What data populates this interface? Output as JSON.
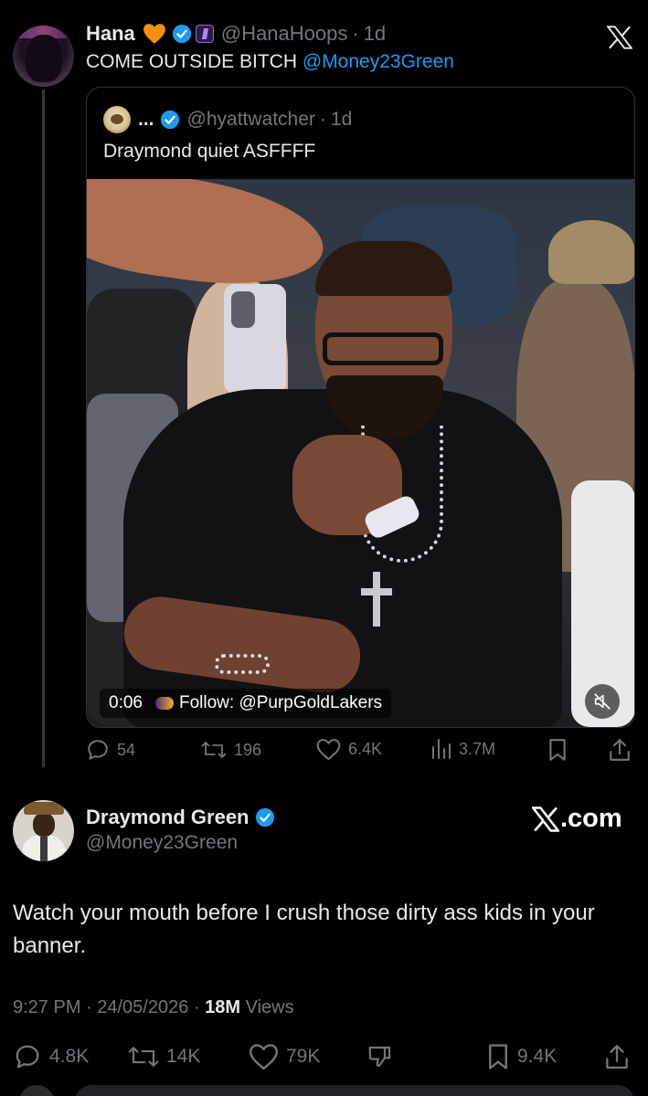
{
  "parent_tweet": {
    "name": "Hana",
    "handle": "@HanaHoops",
    "separator": "·",
    "time": "1d",
    "text_prefix": "COME OUTSIDE BITCH ",
    "mention": "@Money23Green"
  },
  "quote": {
    "name": "...",
    "handle": "@hyattwatcher",
    "separator": "·",
    "time": "1d",
    "text": "Draymond quiet ASFFFF",
    "video_time": "0:06",
    "video_overlay": "Follow: @PurpGoldLakers"
  },
  "parent_actions": {
    "replies": "54",
    "reposts": "196",
    "likes": "6.4K",
    "views": "3.7M"
  },
  "reply_tweet": {
    "name": "Draymond Green",
    "handle": "@Money23Green",
    "brand": ".com",
    "text": "Watch your mouth before I crush those dirty ass kids in your banner.",
    "timestamp": "9:27 PM · 24/05/2026 · ",
    "views_count": "18M",
    "views_label": " Views"
  },
  "reply_actions": {
    "replies": "4.8K",
    "reposts": "14K",
    "likes": "79K",
    "bookmarks": "9.4K"
  },
  "colors": {
    "background": "#000000",
    "text": "#e7e9ea",
    "muted": "#71767b",
    "link": "#1d9bf0",
    "verified": "#1d9bf0",
    "heart_emoji": "#f4900c"
  },
  "icons": [
    "x-logo-icon",
    "verified-badge-icon",
    "orange-heart-icon",
    "affiliate-badge-icon",
    "reply-icon",
    "repost-icon",
    "like-icon",
    "views-icon",
    "bookmark-icon",
    "share-icon",
    "dislike-icon",
    "mute-icon"
  ]
}
